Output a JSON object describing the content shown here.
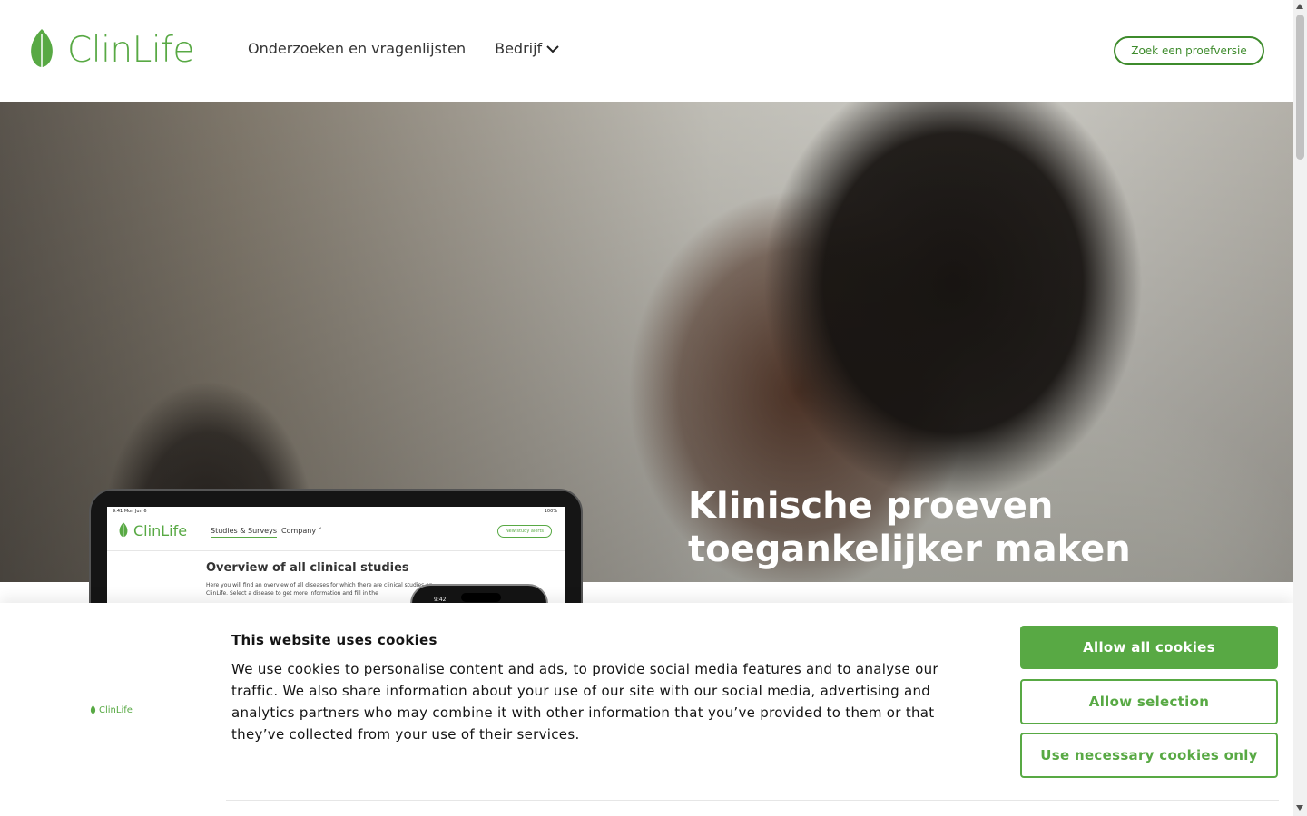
{
  "brand": {
    "name": "ClinLife",
    "color": "#58a944",
    "dark_color": "#3e8b2c"
  },
  "header": {
    "nav": [
      {
        "label": "Onderzoeken en vragenlijsten"
      },
      {
        "label": "Bedrijf",
        "icon": "chevron-down-icon"
      }
    ],
    "cta_label": "Zoek een proefversie"
  },
  "hero": {
    "title_line1": "Klinische proeven",
    "title_line2": "toegankelijker maken"
  },
  "mockup": {
    "status_time": "9:41  Mon Jun 6",
    "status_right": "100%",
    "logo": "ClinLife",
    "nav1": "Studies & Surveys",
    "nav2": "Company",
    "button": "New study alerts",
    "heading": "Overview of all clinical studies",
    "body": "Here you will find an overview of all diseases for which there are clinical studies on ClinLife. Select a disease to get more information and fill in the",
    "phone_time": "9:42"
  },
  "cookie": {
    "logo": "ClinLife",
    "title": "This website uses cookies",
    "text": "We use cookies to personalise content and ads, to provide social media features and to analyse our traffic. We also share information about your use of our site with our social media, advertising and analytics partners who may combine it with other information that you’ve provided to them or that they’ve collected from your use of their services.",
    "allow_all": "Allow all cookies",
    "allow_selection": "Allow selection",
    "necessary_only": "Use necessary cookies only"
  }
}
